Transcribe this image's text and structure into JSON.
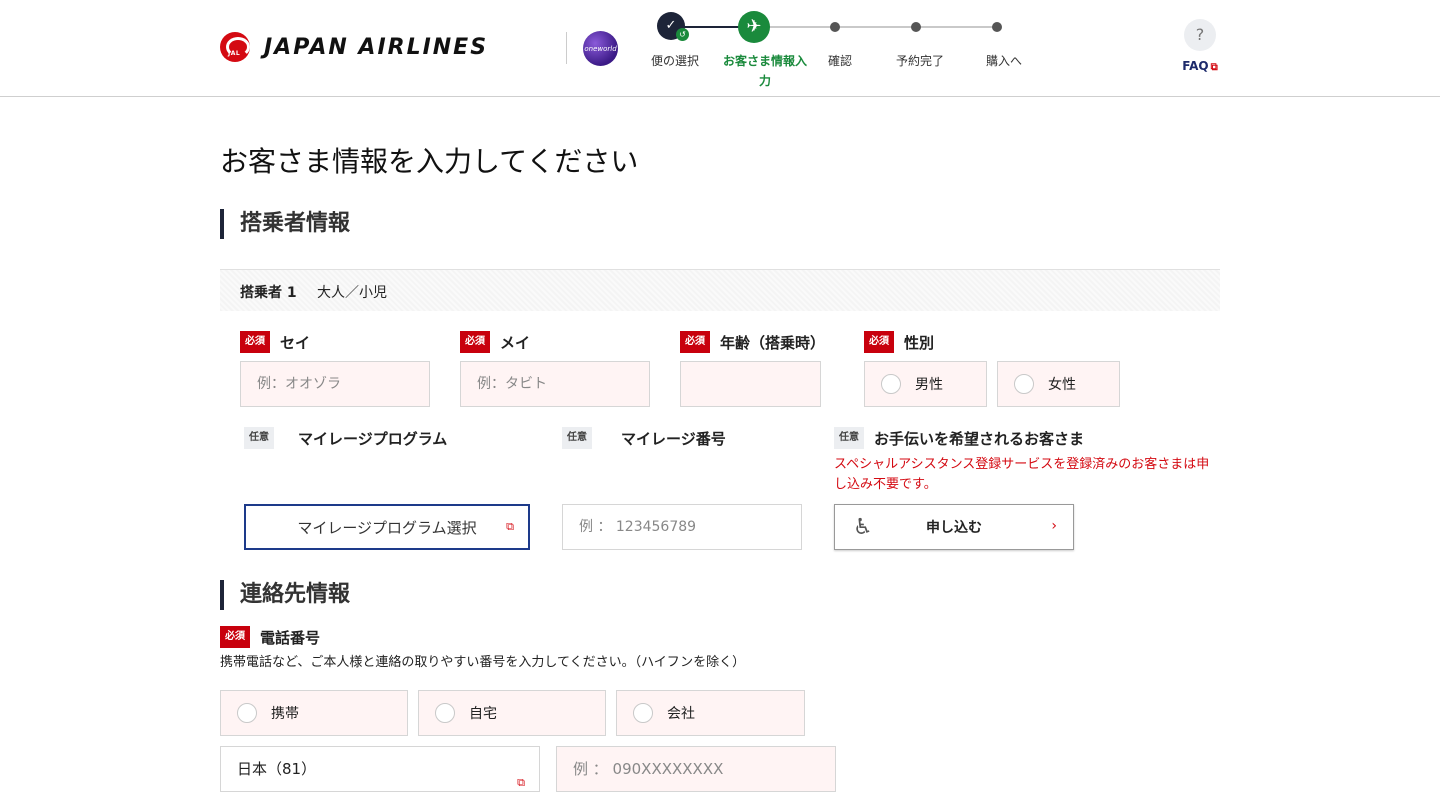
{
  "header": {
    "brand": "JAPAN AIRLINES",
    "crane_text": "JAL",
    "alliance": "oneworld",
    "steps": [
      {
        "label": "便の選択",
        "state": "done"
      },
      {
        "label": "お客さま情報入力",
        "state": "active"
      },
      {
        "label": "確認",
        "state": "todo"
      },
      {
        "label": "予約完了",
        "state": "todo"
      },
      {
        "label": "購入へ",
        "state": "todo"
      }
    ],
    "faq_icon": "?",
    "faq_label": "FAQ"
  },
  "page_title": "お客さま情報を入力してください",
  "passenger_section": {
    "title": "搭乗者情報",
    "pax_label": "搭乗者 1",
    "pax_type": "大人／小児",
    "required_badge": "必須",
    "optional_badge": "任意",
    "sei_label": "セイ",
    "sei_placeholder": "例：オオゾラ",
    "mei_label": "メイ",
    "mei_placeholder": "例：タビト",
    "age_label": "年齢（搭乗時）",
    "gender_label": "性別",
    "gender_male": "男性",
    "gender_female": "女性",
    "mileage_program_label": "マイレージプログラム",
    "mileage_program_button": "マイレージプログラム選択",
    "mileage_number_label": "マイレージ番号",
    "mileage_number_placeholder": "例 ： 123456789",
    "assist_label": "お手伝いを希望されるお客さま",
    "assist_note": "スペシャルアシスタンス登録サービスを登録済みのお客さまは申し込み不要です。",
    "assist_button": "申し込む"
  },
  "contact_section": {
    "title": "連絡先情報",
    "phone_label": "電話番号",
    "phone_note": "携帯電話など、ご本人様と連絡の取りやすい番号を入力してください。（ハイフンを除く）",
    "phone_types": [
      "携帯",
      "自宅",
      "会社"
    ],
    "country": "日本（81）",
    "phone_placeholder": "例 ： 090XXXXXXXX"
  },
  "colors": {
    "brand_red": "#d40a12",
    "navy": "#1d2438",
    "step_green": "#1a8a3c",
    "required_red": "#c8000d",
    "input_pink": "#fff4f4"
  }
}
